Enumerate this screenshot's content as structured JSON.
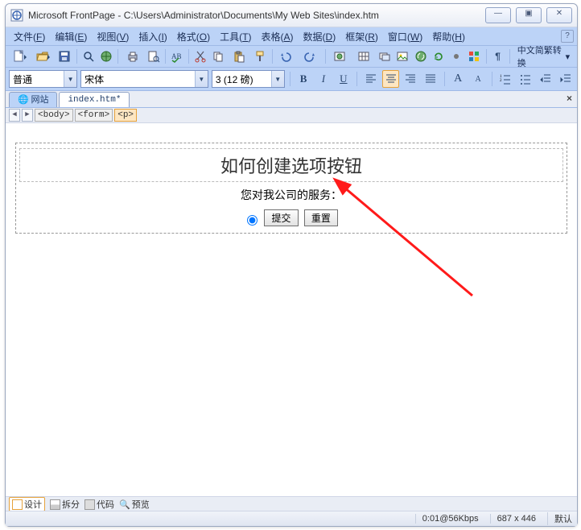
{
  "window": {
    "title": "Microsoft FrontPage - C:\\Users\\Administrator\\Documents\\My Web Sites\\index.htm",
    "btn_min": "—",
    "btn_max": "▣",
    "btn_close": "✕"
  },
  "menubar": {
    "items": [
      {
        "label": "文件",
        "accel": "F"
      },
      {
        "label": "编辑",
        "accel": "E"
      },
      {
        "label": "视图",
        "accel": "V"
      },
      {
        "label": "插入",
        "accel": "I"
      },
      {
        "label": "格式",
        "accel": "O"
      },
      {
        "label": "工具",
        "accel": "T"
      },
      {
        "label": "表格",
        "accel": "A"
      },
      {
        "label": "数据",
        "accel": "D"
      },
      {
        "label": "框架",
        "accel": "R"
      },
      {
        "label": "窗口",
        "accel": "W"
      },
      {
        "label": "帮助",
        "accel": "H"
      }
    ],
    "help_icon": "?"
  },
  "format": {
    "style": "普通",
    "font": "宋体",
    "size": "3 (12 磅)",
    "cn_convert": "中文简繁转换"
  },
  "tabs": {
    "site": "网站",
    "file": "index.htm*",
    "close": "×"
  },
  "tagbar": {
    "nav_prev": "◀",
    "nav_next": "▶",
    "tags": [
      "<body>",
      "<form>",
      "<p>"
    ]
  },
  "content": {
    "heading": "如何创建选项按钮",
    "subtitle": "您对我公司的服务：",
    "submit": "提交",
    "reset": "重置"
  },
  "viewbar": {
    "design": "设计",
    "split": "拆分",
    "code": "代码",
    "preview": "预览"
  },
  "status": {
    "speed": "0:01@56Kbps",
    "dims": "687 x 446",
    "mode": "默认"
  },
  "icons": {
    "new": "new-doc-icon",
    "open": "open-icon",
    "save": "save-icon",
    "find": "find-icon",
    "publish": "publish-icon",
    "print": "print-icon",
    "preview": "preview-icon",
    "spell": "spell-icon",
    "cut": "cut-icon",
    "copy": "copy-icon",
    "paste": "paste-icon",
    "fmtpaint": "format-painter-icon",
    "undo": "undo-icon",
    "redo": "redo-icon",
    "web": "web-component-icon",
    "table": "table-icon",
    "layer": "layer-icon",
    "pic": "picture-icon",
    "link": "hyperlink-icon",
    "refresh": "refresh-icon",
    "task": "task-icon",
    "msn": "ms-icon",
    "showall": "showall-icon"
  }
}
